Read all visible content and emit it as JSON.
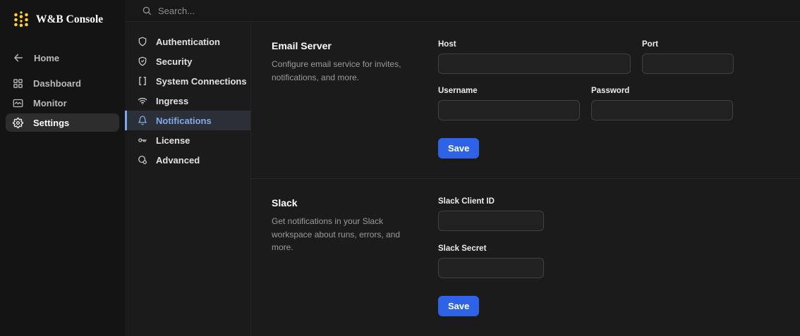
{
  "logo": {
    "title": "W&B Console"
  },
  "topbar": {
    "search_placeholder": "Search..."
  },
  "primary_nav": {
    "items": [
      {
        "label": "Home",
        "icon": "arrow-left"
      },
      {
        "label": "Dashboard",
        "icon": "dashboard-grid"
      },
      {
        "label": "Monitor",
        "icon": "monitor-wave"
      },
      {
        "label": "Settings",
        "icon": "gear",
        "selected": true
      }
    ]
  },
  "settings_nav": {
    "items": [
      {
        "label": "Authentication",
        "icon": "shield"
      },
      {
        "label": "Security",
        "icon": "shield-check"
      },
      {
        "label": "System Connections",
        "icon": "brackets"
      },
      {
        "label": "Ingress",
        "icon": "wifi"
      },
      {
        "label": "Notifications",
        "icon": "bell",
        "selected": true
      },
      {
        "label": "License",
        "icon": "key"
      },
      {
        "label": "Advanced",
        "icon": "advanced-gear"
      }
    ]
  },
  "sections": [
    {
      "title": "Email Server",
      "description": "Configure email service for invites, notifications, and more.",
      "fields": [
        {
          "label": "Host",
          "value": ""
        },
        {
          "label": "Port",
          "value": ""
        },
        {
          "label": "Username",
          "value": ""
        },
        {
          "label": "Password",
          "value": ""
        }
      ],
      "save_label": "Save"
    },
    {
      "title": "Slack",
      "description": "Get notifications in your Slack workspace about runs, errors, and more.",
      "fields": [
        {
          "label": "Slack Client ID",
          "value": ""
        },
        {
          "label": "Slack Secret",
          "value": ""
        }
      ],
      "save_label": "Save"
    }
  ],
  "colors": {
    "accent_blue": "#2e63e7",
    "selected_link_blue": "#82a9ea",
    "selected_row_bg": "#2b2f38",
    "logo_gold": "#ffcc33",
    "sidebar_bg": "#141414",
    "page_bg": "#1b1b1b"
  }
}
